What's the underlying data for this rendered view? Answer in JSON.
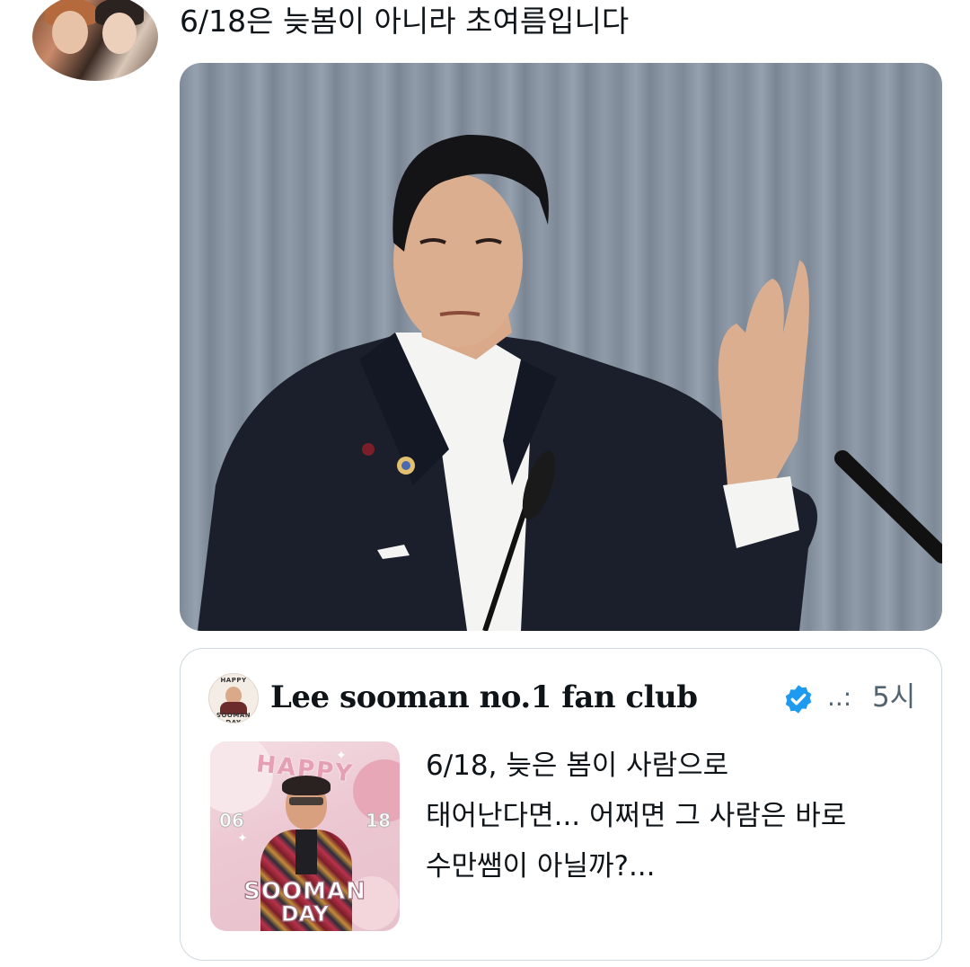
{
  "tweet": {
    "text": "6/18은 늦봄이 아니라 초여름입니다"
  },
  "quoted_tweet": {
    "display_name": "Lee sooman no.1 fan club",
    "more_indicator": "..:",
    "time": "5시",
    "body_lines": [
      "6/18, 늦은 봄이 사람으로",
      "태어난다면... 어쩌면 그 사람은 바로",
      "수만쌤이 아닐까?..."
    ],
    "avatar_ring_top": "HAPPY",
    "avatar_ring_bottom": "SOOMAN DAY",
    "poster": {
      "happy": "HAPPY",
      "date_left": "06",
      "date_right": "18",
      "line1": "SOOMAN",
      "line2": "DAY"
    }
  },
  "colors": {
    "text_primary": "#0f1419",
    "text_secondary": "#536471",
    "border": "#cfd9de",
    "verified_badge": "#1d9bf0"
  },
  "icons": {
    "verified": "verified-badge-icon"
  }
}
